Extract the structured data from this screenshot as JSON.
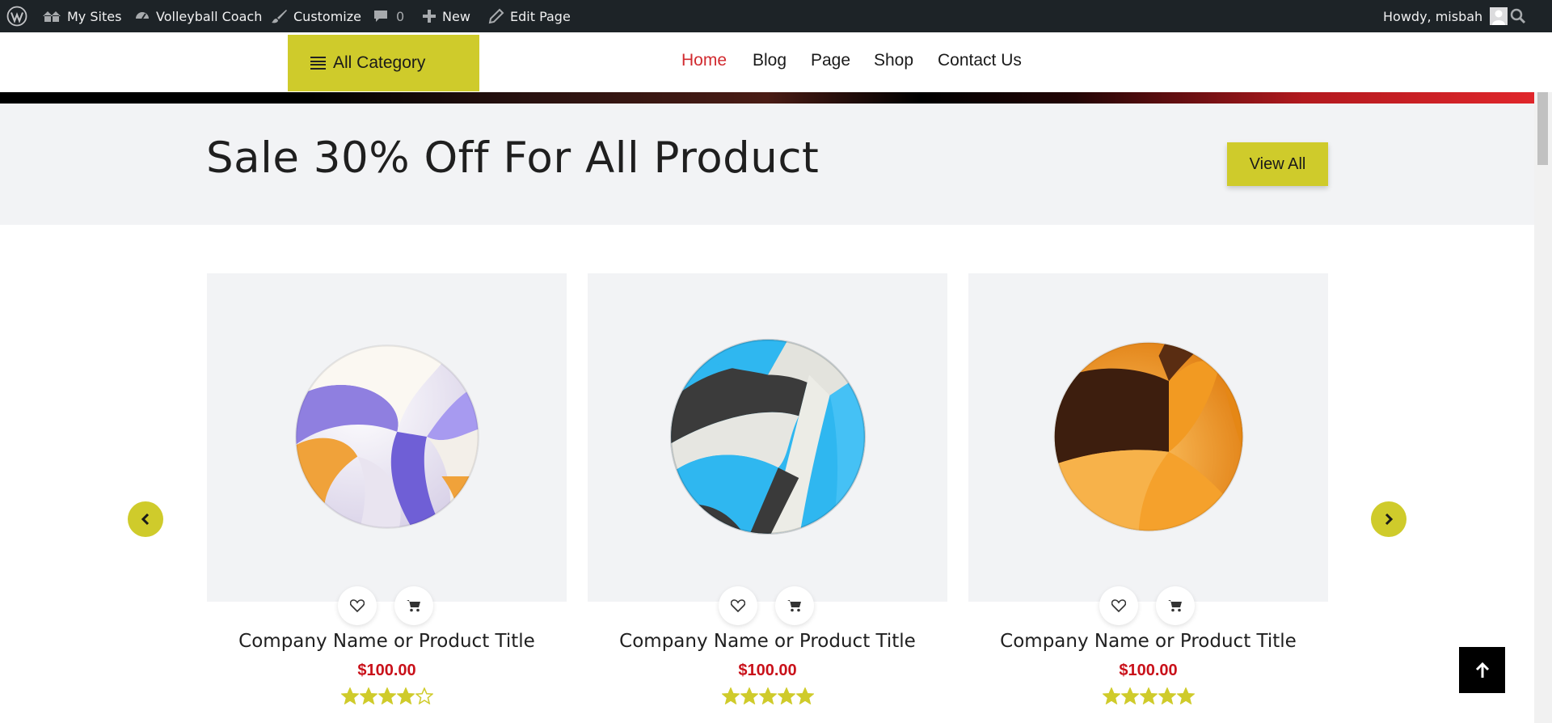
{
  "admin_bar": {
    "my_sites": "My Sites",
    "site_name": "Volleyball Coach",
    "customize": "Customize",
    "comments_count": "0",
    "new": "New",
    "edit_page": "Edit Page",
    "howdy": "Howdy, misbah"
  },
  "header": {
    "category_button": "All Category",
    "nav": [
      "Home",
      "Blog",
      "Page",
      "Shop",
      "Contact Us"
    ],
    "active_nav": "Home"
  },
  "sale": {
    "title": "Sale 30% Off For All Product",
    "view_all": "View All"
  },
  "products": [
    {
      "title": "Company Name or Product Title",
      "price": "$100.00",
      "rating": 4,
      "ball": "volleyball-purple-icon"
    },
    {
      "title": "Company Name or Product Title",
      "price": "$100.00",
      "rating": 5,
      "ball": "volleyball-blue-icon"
    },
    {
      "title": "Company Name or Product Title",
      "price": "$100.00",
      "rating": 5,
      "ball": "volleyball-orange-icon"
    }
  ],
  "colors": {
    "accent": "#cfcb2b",
    "nav_active": "#d12a2f",
    "price": "#c9111a",
    "admin_bar": "#1d2327"
  }
}
